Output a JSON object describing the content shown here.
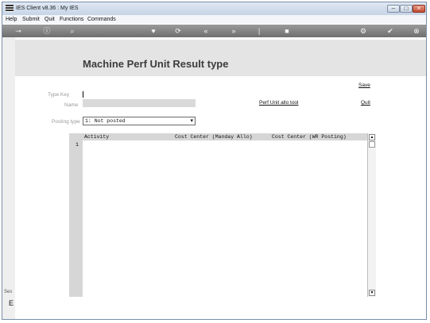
{
  "window": {
    "title": "IES Client v8.36 : My IES"
  },
  "menu": {
    "items": [
      "Help",
      "Submit",
      "Quit",
      "Functions",
      "Commands"
    ]
  },
  "toolbar": {
    "icons": [
      "key-icon",
      "info-icon",
      "search-icon",
      "heart-icon",
      "refresh-icon",
      "back-icon",
      "forward-icon",
      "pipe-icon",
      "stop-icon",
      "settings-icon",
      "check-icon",
      "close-icon"
    ],
    "glyphs": [
      "⊸",
      "ⓘ",
      "⌕",
      "♥",
      "⟳",
      "«",
      "»",
      "|",
      "■",
      "⚙",
      "✔",
      "⊗"
    ]
  },
  "page": {
    "title": "Machine Perf Unit Result type"
  },
  "sidebar": {
    "fragment_1": "Ses",
    "fragment_2": "E"
  },
  "form": {
    "type_key_label": "Type Key",
    "type_key_value": "",
    "name_label": "Name",
    "name_value": "",
    "posting_type_label": "Posting type",
    "posting_type_value": "1: Not posted"
  },
  "actions": {
    "save": "Save",
    "quit": "Quit",
    "perf_unit_tool": "Perf Unit allo tool"
  },
  "grid": {
    "columns": [
      "Activity",
      "Cost Center (Manday Allo)",
      "Cost Center (WR Posting)"
    ],
    "rows": [
      {
        "num": "1"
      }
    ]
  },
  "colors": {
    "title_text": "#3c3c3c",
    "header_band": "#e4e4e4",
    "toolbar": "#858585"
  }
}
